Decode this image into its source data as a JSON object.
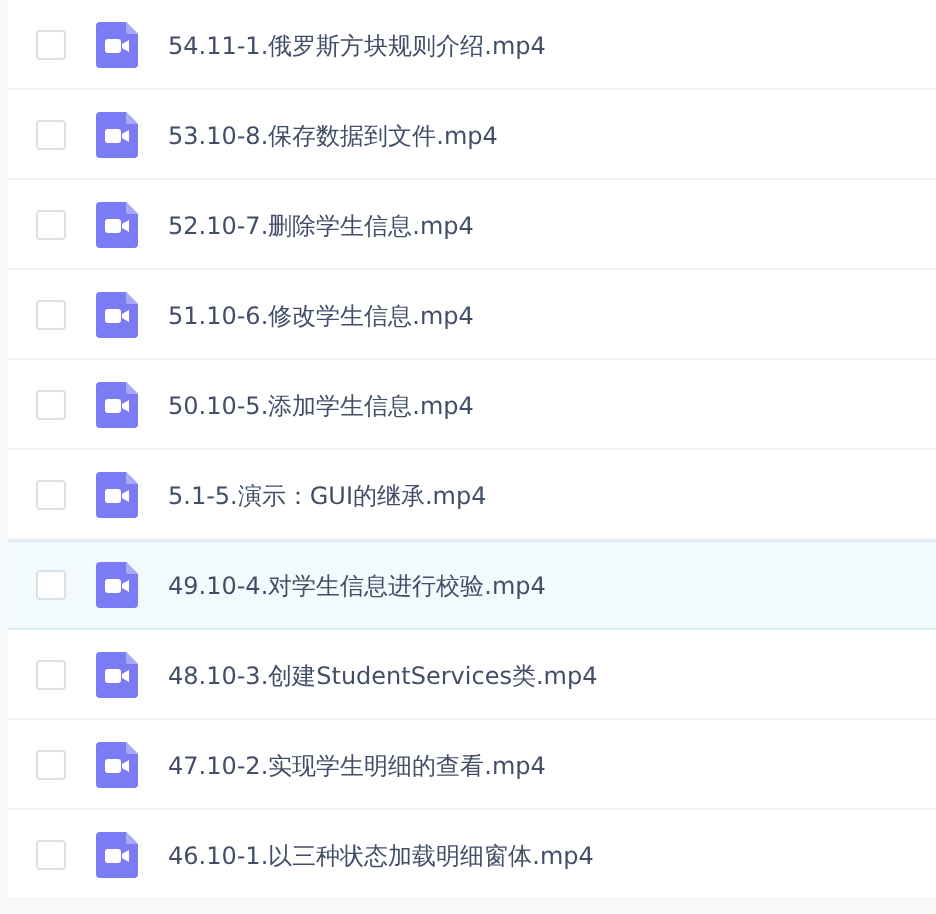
{
  "files": [
    {
      "name": "54.11-1.俄罗斯方块规则介绍.mp4",
      "checked": false,
      "highlighted": false
    },
    {
      "name": "53.10-8.保存数据到文件.mp4",
      "checked": false,
      "highlighted": false
    },
    {
      "name": "52.10-7.删除学生信息.mp4",
      "checked": false,
      "highlighted": false
    },
    {
      "name": "51.10-6.修改学生信息.mp4",
      "checked": false,
      "highlighted": false
    },
    {
      "name": "50.10-5.添加学生信息.mp4",
      "checked": false,
      "highlighted": false
    },
    {
      "name": "5.1-5.演示：GUI的继承.mp4",
      "checked": false,
      "highlighted": false
    },
    {
      "name": "49.10-4.对学生信息进行校验.mp4",
      "checked": false,
      "highlighted": true
    },
    {
      "name": "48.10-3.创建StudentServices类.mp4",
      "checked": false,
      "highlighted": false
    },
    {
      "name": "47.10-2.实现学生明细的查看.mp4",
      "checked": false,
      "highlighted": false
    },
    {
      "name": "46.10-1.以三种状态加载明细窗体.mp4",
      "checked": false,
      "highlighted": false
    }
  ]
}
